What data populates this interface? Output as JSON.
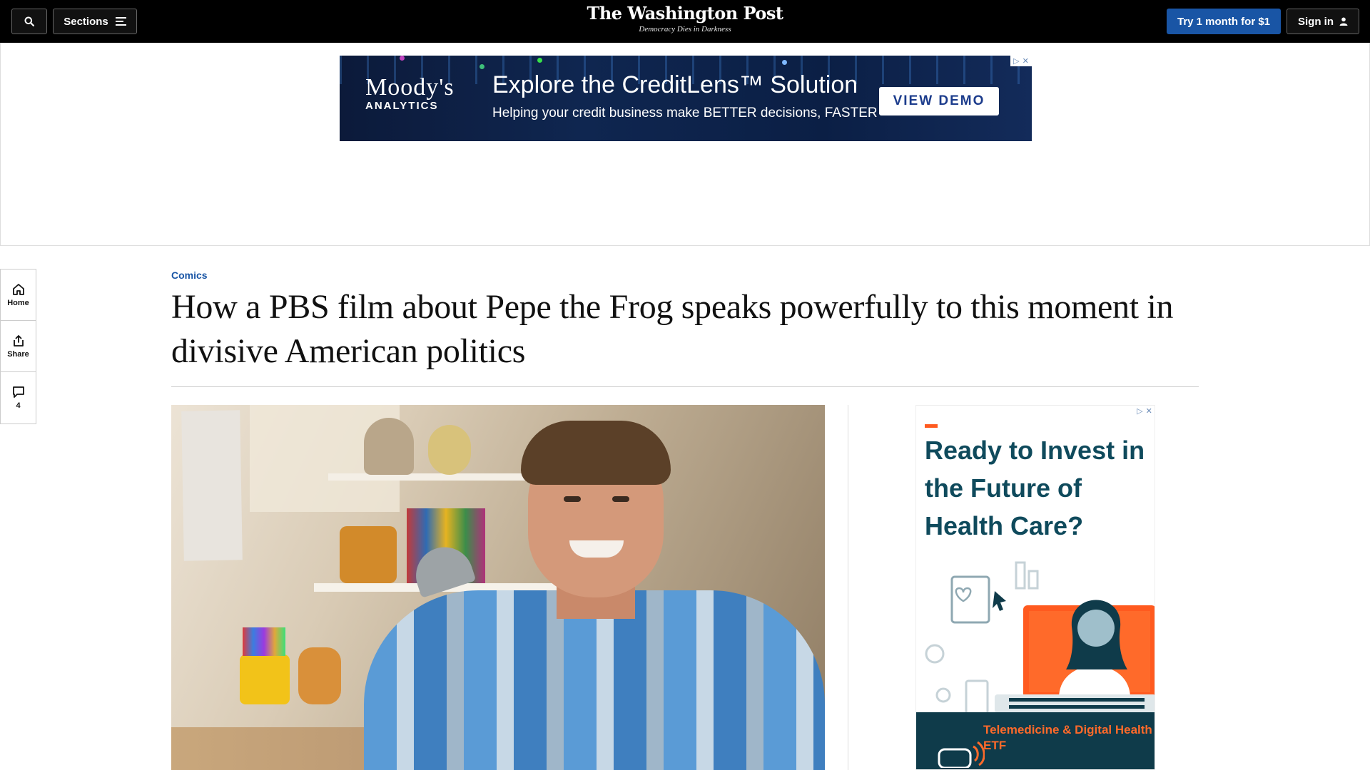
{
  "header": {
    "sections_label": "Sections",
    "brand": "The Washington Post",
    "tagline": "Democracy Dies in Darkness",
    "subscribe_label": "Try 1 month for $1",
    "signin_label": "Sign in"
  },
  "top_ad": {
    "logo_main": "Moody's",
    "logo_sub": "ANALYTICS",
    "headline": "Explore the CreditLens™ Solution",
    "subline": "Helping your credit business make BETTER decisions, FASTER",
    "cta": "VIEW DEMO"
  },
  "rail": {
    "home_label": "Home",
    "share_label": "Share",
    "comments_count": "4"
  },
  "article": {
    "kicker": "Comics",
    "headline": "How a PBS film about Pepe the Frog speaks powerfully to this moment in divisive American politics"
  },
  "side_ad": {
    "headline": "Ready to Invest in the Future of Health Care?",
    "footer": "Telemedicine & Digital Health ETF"
  },
  "colors": {
    "topbar": "#000000",
    "accent_blue": "#1955a5",
    "ad_orange": "#ff5a1f",
    "ad_teal": "#0f4a5c"
  }
}
